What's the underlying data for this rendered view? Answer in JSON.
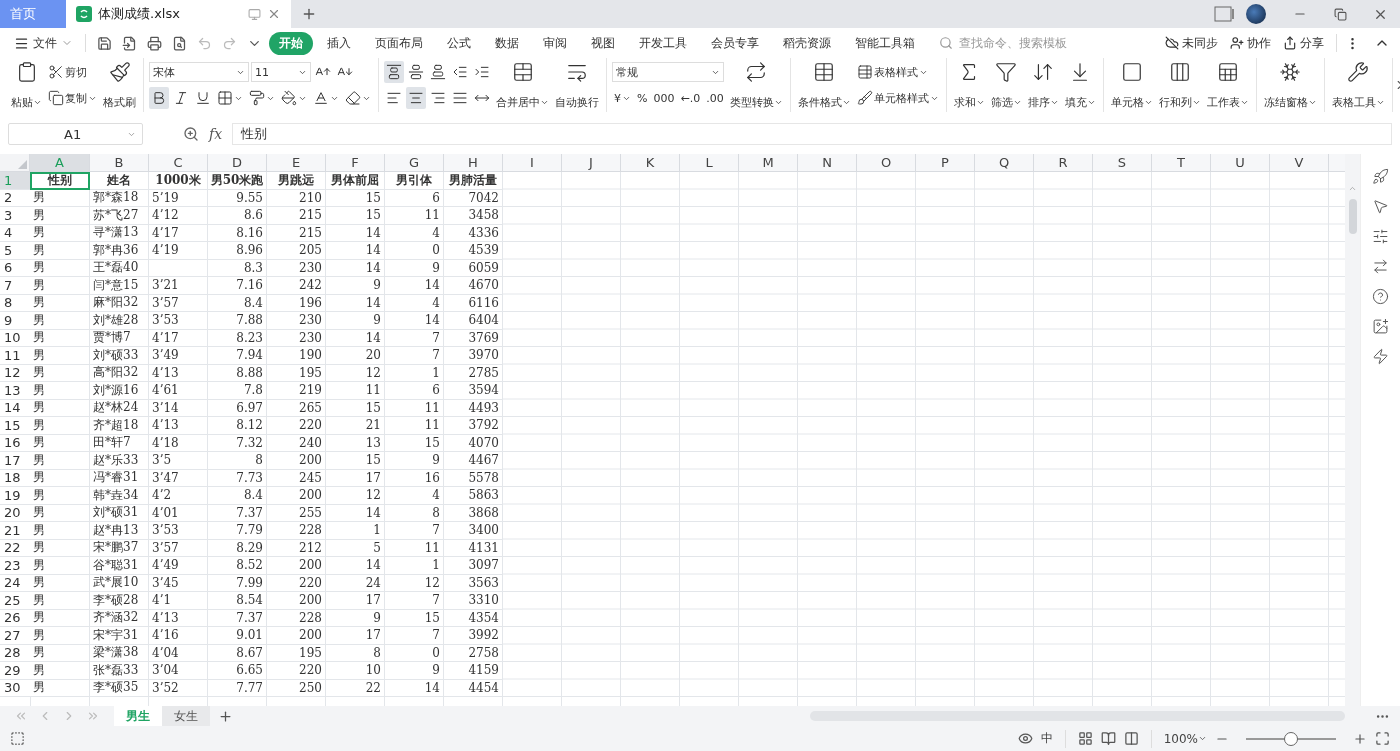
{
  "window_tabs": [
    {
      "label": "首页",
      "kind": "home",
      "selected": false
    },
    {
      "label": "体测成绩.xlsx",
      "kind": "file",
      "selected": true
    }
  ],
  "menu_bar": {
    "file_menu": "文件",
    "tabs": [
      {
        "label": "开始",
        "selected": true
      },
      {
        "label": "插入",
        "selected": false
      },
      {
        "label": "页面布局",
        "selected": false
      },
      {
        "label": "公式",
        "selected": false
      },
      {
        "label": "数据",
        "selected": false
      },
      {
        "label": "审阅",
        "selected": false
      },
      {
        "label": "视图",
        "selected": false
      },
      {
        "label": "开发工具",
        "selected": false
      },
      {
        "label": "会员专享",
        "selected": false
      },
      {
        "label": "稻壳资源",
        "selected": false
      },
      {
        "label": "智能工具箱",
        "selected": false
      }
    ],
    "search": {
      "placeholder": "查找命令、搜索模板"
    },
    "actions": [
      "未同步",
      "协作",
      "分享"
    ]
  },
  "ribbon": [
    [
      {
        "kind": "big",
        "label": "粘贴",
        "dropdown": true
      },
      {
        "kind": "stack",
        "rows": [
          [
            {
              "kind": "small",
              "label": "剪切",
              "dropdown": false
            }
          ],
          [
            {
              "kind": "small",
              "label": "复制",
              "dropdown": true
            }
          ]
        ]
      },
      {
        "kind": "big",
        "label": "格式刷",
        "dropdown": false
      }
    ],
    [
      {
        "kind": "stack",
        "rows": [
          [
            {
              "kind": "field",
              "value": "宋体"
            },
            {
              "kind": "field",
              "value": "11"
            },
            {
              "kind": "icon",
              "dropdown": false,
              "selected": false
            },
            {
              "kind": "icon",
              "dropdown": false,
              "selected": false
            }
          ],
          [
            {
              "kind": "icon",
              "dropdown": false,
              "selected": true
            },
            {
              "kind": "icon",
              "dropdown": false,
              "selected": false
            },
            {
              "kind": "icon",
              "dropdown": false,
              "selected": false
            },
            {
              "kind": "icon",
              "dropdown": true,
              "selected": false
            },
            {
              "kind": "icon",
              "dropdown": true,
              "selected": false
            },
            {
              "kind": "icon",
              "dropdown": true,
              "selected": false
            },
            {
              "kind": "icon",
              "dropdown": true,
              "selected": false
            },
            {
              "kind": "icon",
              "dropdown": true,
              "selected": false
            }
          ]
        ]
      }
    ],
    [
      {
        "kind": "stack",
        "rows": [
          [
            {
              "kind": "icon",
              "dropdown": false,
              "selected": true
            },
            {
              "kind": "icon",
              "dropdown": false,
              "selected": false
            },
            {
              "kind": "icon",
              "dropdown": false,
              "selected": false
            },
            {
              "kind": "icon",
              "dropdown": false,
              "selected": false
            },
            {
              "kind": "icon",
              "dropdown": false,
              "selected": false
            }
          ],
          [
            {
              "kind": "icon",
              "dropdown": false,
              "selected": false
            },
            {
              "kind": "icon",
              "dropdown": false,
              "selected": true
            },
            {
              "kind": "icon",
              "dropdown": false,
              "selected": false
            },
            {
              "kind": "icon",
              "dropdown": false,
              "selected": false
            },
            {
              "kind": "icon",
              "dropdown": false,
              "selected": false
            }
          ]
        ]
      },
      {
        "kind": "big",
        "label": "合并居中",
        "dropdown": true
      },
      {
        "kind": "big",
        "label": "自动换行",
        "dropdown": false
      }
    ],
    [
      {
        "kind": "stack",
        "rows": [
          [
            {
              "kind": "field",
              "value": "常规"
            }
          ],
          [
            {
              "kind": "glyph",
              "label": "¥",
              "dropdown": true
            },
            {
              "kind": "glyph",
              "label": "%",
              "dropdown": false
            },
            {
              "kind": "glyph",
              "label": "000",
              "dropdown": false
            },
            {
              "kind": "glyph",
              "label": "←.0",
              "dropdown": false
            },
            {
              "kind": "glyph",
              "label": ".00",
              "dropdown": false
            }
          ]
        ]
      },
      {
        "kind": "big",
        "label": "类型转换",
        "dropdown": true
      }
    ],
    [
      {
        "kind": "big",
        "label": "条件格式",
        "dropdown": true
      },
      {
        "kind": "stack",
        "rows": [
          [
            {
              "kind": "small",
              "label": "表格样式",
              "dropdown": true
            }
          ],
          [
            {
              "kind": "small",
              "label": "单元格样式",
              "dropdown": true
            }
          ]
        ]
      }
    ],
    [
      {
        "kind": "big",
        "label": "求和",
        "dropdown": true
      },
      {
        "kind": "big",
        "label": "筛选",
        "dropdown": true
      },
      {
        "kind": "big",
        "label": "排序",
        "dropdown": true
      },
      {
        "kind": "big",
        "label": "填充",
        "dropdown": true
      }
    ],
    [
      {
        "kind": "big",
        "label": "单元格",
        "dropdown": true
      },
      {
        "kind": "big",
        "label": "行和列",
        "dropdown": true
      },
      {
        "kind": "big",
        "label": "工作表",
        "dropdown": true
      }
    ],
    [
      {
        "kind": "big",
        "label": "冻结窗格",
        "dropdown": true
      }
    ],
    [
      {
        "kind": "big",
        "label": "表格工具",
        "dropdown": true
      }
    ]
  ],
  "formula_bar": {
    "cell_reference": "A1",
    "fx": "fx",
    "value": "性别"
  },
  "sheet": {
    "columns": [
      {
        "label": "A",
        "selected": true
      },
      {
        "label": "B",
        "selected": false
      },
      {
        "label": "C",
        "selected": false
      },
      {
        "label": "D",
        "selected": false
      },
      {
        "label": "E",
        "selected": false
      },
      {
        "label": "F",
        "selected": false
      },
      {
        "label": "G",
        "selected": false
      },
      {
        "label": "H",
        "selected": false
      },
      {
        "label": "I",
        "selected": false
      },
      {
        "label": "J",
        "selected": false
      },
      {
        "label": "K",
        "selected": false
      },
      {
        "label": "L",
        "selected": false
      },
      {
        "label": "M",
        "selected": false
      },
      {
        "label": "N",
        "selected": false
      },
      {
        "label": "O",
        "selected": false
      },
      {
        "label": "P",
        "selected": false
      },
      {
        "label": "Q",
        "selected": false
      },
      {
        "label": "R",
        "selected": false
      },
      {
        "label": "S",
        "selected": false
      },
      {
        "label": "T",
        "selected": false
      },
      {
        "label": "U",
        "selected": false
      },
      {
        "label": "V",
        "selected": false
      }
    ],
    "rows": [
      {
        "number": "1",
        "kind": "header",
        "selected": true,
        "cells": [
          "性别",
          "姓名",
          "1000米",
          "男50米跑",
          "男跳远",
          "男体前屈",
          "男引体",
          "男肺活量"
        ]
      },
      {
        "number": "2",
        "kind": "data",
        "selected": false,
        "cells": [
          "男",
          "郭*森18",
          "5’19",
          "9.55",
          "210",
          "15",
          "6",
          "7042"
        ]
      },
      {
        "number": "3",
        "kind": "data",
        "selected": false,
        "cells": [
          "男",
          "苏*飞27",
          "4’12",
          "8.6",
          "215",
          "15",
          "11",
          "3458"
        ]
      },
      {
        "number": "4",
        "kind": "data",
        "selected": false,
        "cells": [
          "男",
          "寻*潇13",
          "4’17",
          "8.16",
          "215",
          "14",
          "4",
          "4336"
        ]
      },
      {
        "number": "5",
        "kind": "data",
        "selected": false,
        "cells": [
          "男",
          "郭*冉36",
          "4’19",
          "8.96",
          "205",
          "14",
          "0",
          "4539"
        ]
      },
      {
        "number": "6",
        "kind": "data",
        "selected": false,
        "cells": [
          "男",
          "王*磊40",
          null,
          "8.3",
          "230",
          "14",
          "9",
          "6059"
        ]
      },
      {
        "number": "7",
        "kind": "data",
        "selected": false,
        "cells": [
          "男",
          "闫*意15",
          "3’21",
          "7.16",
          "242",
          "9",
          "14",
          "4670"
        ]
      },
      {
        "number": "8",
        "kind": "data",
        "selected": false,
        "cells": [
          "男",
          "麻*阳32",
          "3’57",
          "8.4",
          "196",
          "14",
          "4",
          "6116"
        ]
      },
      {
        "number": "9",
        "kind": "data",
        "selected": false,
        "cells": [
          "男",
          "刘*雄28",
          "3’53",
          "7.88",
          "230",
          "9",
          "14",
          "6404"
        ]
      },
      {
        "number": "10",
        "kind": "data",
        "selected": false,
        "cells": [
          "男",
          "贾*博7",
          "4’17",
          "8.23",
          "230",
          "14",
          "7",
          "3769"
        ]
      },
      {
        "number": "11",
        "kind": "data",
        "selected": false,
        "cells": [
          "男",
          "刘*硕33",
          "3’49",
          "7.94",
          "190",
          "20",
          "7",
          "3970"
        ]
      },
      {
        "number": "12",
        "kind": "data",
        "selected": false,
        "cells": [
          "男",
          "高*阳32",
          "4’13",
          "8.88",
          "195",
          "12",
          "1",
          "2785"
        ]
      },
      {
        "number": "13",
        "kind": "data",
        "selected": false,
        "cells": [
          "男",
          "刘*源16",
          "4’61",
          "7.8",
          "219",
          "11",
          "6",
          "3594"
        ]
      },
      {
        "number": "14",
        "kind": "data",
        "selected": false,
        "cells": [
          "男",
          "赵*林24",
          "3’14",
          "6.97",
          "265",
          "15",
          "11",
          "4493"
        ]
      },
      {
        "number": "15",
        "kind": "data",
        "selected": false,
        "cells": [
          "男",
          "齐*超18",
          "4’13",
          "8.12",
          "220",
          "21",
          "11",
          "3792"
        ]
      },
      {
        "number": "16",
        "kind": "data",
        "selected": false,
        "cells": [
          "男",
          "田*轩7",
          "4’18",
          "7.32",
          "240",
          "13",
          "15",
          "4070"
        ]
      },
      {
        "number": "17",
        "kind": "data",
        "selected": false,
        "cells": [
          "男",
          "赵*乐33",
          "3’5",
          "8",
          "200",
          "15",
          "9",
          "4467"
        ]
      },
      {
        "number": "18",
        "kind": "data",
        "selected": false,
        "cells": [
          "男",
          "冯*睿31",
          "3’47",
          "7.73",
          "245",
          "17",
          "16",
          "5578"
        ]
      },
      {
        "number": "19",
        "kind": "data",
        "selected": false,
        "cells": [
          "男",
          "韩*垚34",
          "4’2",
          "8.4",
          "200",
          "12",
          "4",
          "5863"
        ]
      },
      {
        "number": "20",
        "kind": "data",
        "selected": false,
        "cells": [
          "男",
          "刘*硕31",
          "4’01",
          "7.37",
          "255",
          "14",
          "8",
          "3868"
        ]
      },
      {
        "number": "21",
        "kind": "data",
        "selected": false,
        "cells": [
          "男",
          "赵*冉13",
          "3’53",
          "7.79",
          "228",
          "1",
          "7",
          "3400"
        ]
      },
      {
        "number": "22",
        "kind": "data",
        "selected": false,
        "cells": [
          "男",
          "宋*鹏37",
          "3’57",
          "8.29",
          "212",
          "5",
          "11",
          "4131"
        ]
      },
      {
        "number": "23",
        "kind": "data",
        "selected": false,
        "cells": [
          "男",
          "谷*聪31",
          "4’49",
          "8.52",
          "200",
          "14",
          "1",
          "3097"
        ]
      },
      {
        "number": "24",
        "kind": "data",
        "selected": false,
        "cells": [
          "男",
          "武*展10",
          "3’45",
          "7.99",
          "220",
          "24",
          "12",
          "3563"
        ]
      },
      {
        "number": "25",
        "kind": "data",
        "selected": false,
        "cells": [
          "男",
          "李*硕28",
          "4’1",
          "8.54",
          "200",
          "17",
          "7",
          "3310"
        ]
      },
      {
        "number": "26",
        "kind": "data",
        "selected": false,
        "cells": [
          "男",
          "齐*涵32",
          "4’13",
          "7.37",
          "228",
          "9",
          "15",
          "4354"
        ]
      },
      {
        "number": "27",
        "kind": "data",
        "selected": false,
        "cells": [
          "男",
          "宋*宇31",
          "4’16",
          "9.01",
          "200",
          "17",
          "7",
          "3992"
        ]
      },
      {
        "number": "28",
        "kind": "data",
        "selected": false,
        "cells": [
          "男",
          "梁*潇38",
          "4’04",
          "8.67",
          "195",
          "8",
          "0",
          "2758"
        ]
      },
      {
        "number": "29",
        "kind": "data",
        "selected": false,
        "cells": [
          "男",
          "张*磊33",
          "3’04",
          "6.65",
          "220",
          "10",
          "9",
          "4159"
        ]
      },
      {
        "number": "30",
        "kind": "data",
        "selected": false,
        "cells": [
          "男",
          "李*硕35",
          "3’52",
          "7.77",
          "250",
          "22",
          "14",
          "4454"
        ]
      }
    ]
  },
  "sheet_tabs": [
    {
      "label": "男生",
      "selected": true
    },
    {
      "label": "女生",
      "selected": false
    }
  ],
  "status_bar": {
    "input_method": "中",
    "zoom": "100%",
    "zoom_slider": {
      "level": 0.5
    }
  }
}
